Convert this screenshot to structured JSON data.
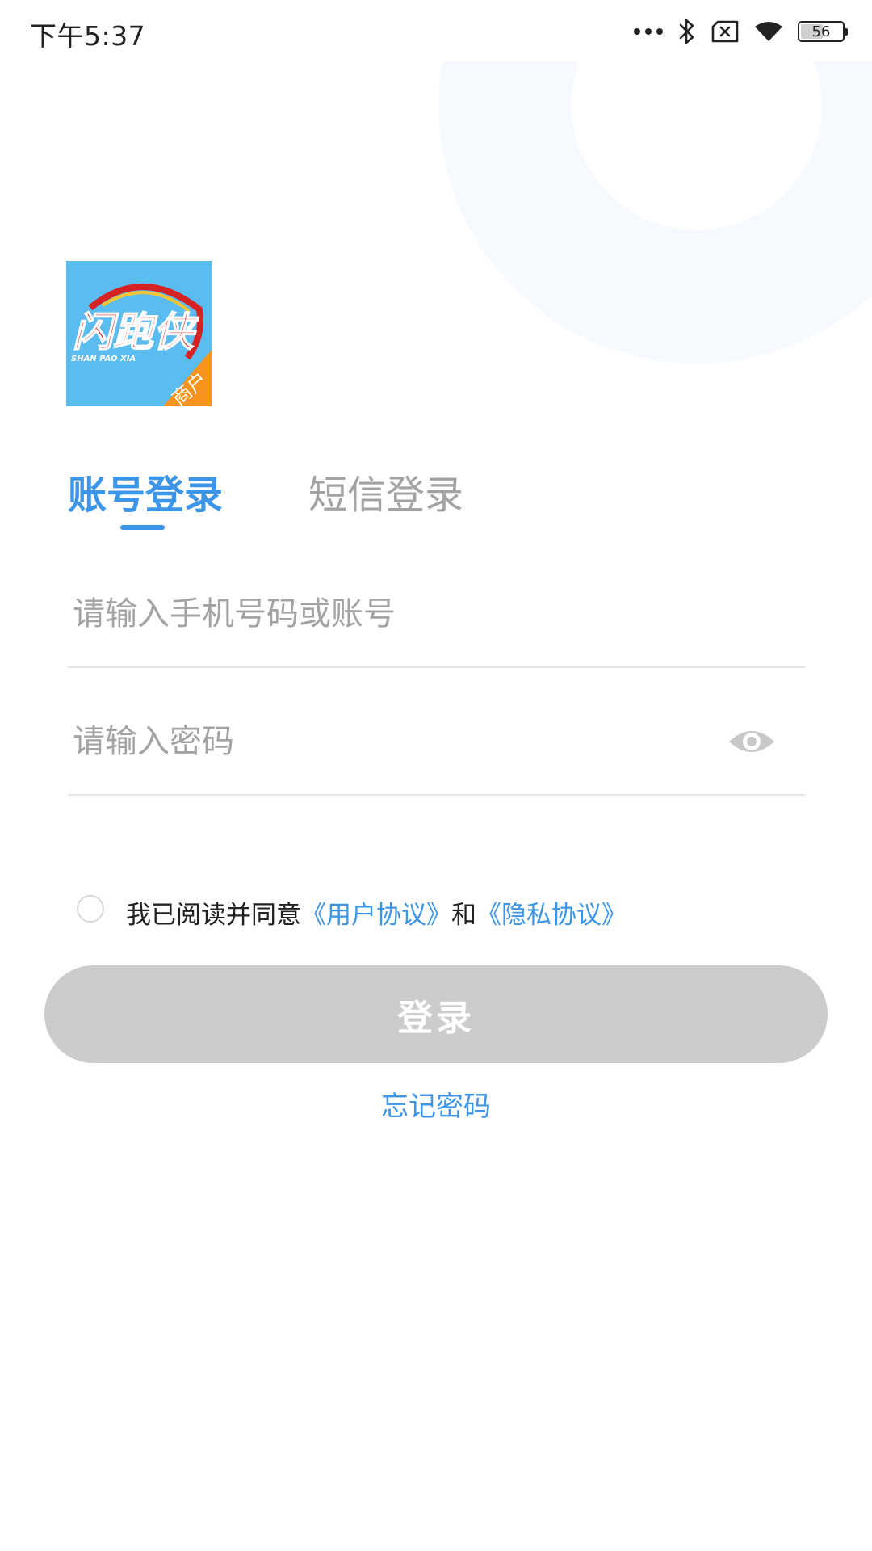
{
  "status_bar": {
    "time": "下午5:37",
    "battery_level": "56",
    "battery_fraction": 0.56
  },
  "logo": {
    "brand_text": "闪跑侠",
    "brand_pinyin": "SHAN PAO XIA",
    "badge_text": "商户",
    "colors": {
      "background": "#5bbcf0",
      "text": "#d52222",
      "badge": "#f7941d"
    }
  },
  "tabs": [
    {
      "label": "账号登录",
      "active": true
    },
    {
      "label": "短信登录",
      "active": false
    }
  ],
  "form": {
    "account_placeholder": "请输入手机号码或账号",
    "password_placeholder": "请输入密码",
    "agreement": {
      "checked": false,
      "prefix": "我已阅读并同意",
      "user_agreement": "《用户协议》",
      "conjunction": "和",
      "privacy_policy": "《隐私协议》"
    },
    "login_button": "登录",
    "forgot_password": "忘记密码"
  },
  "colors": {
    "accent": "#3d95e8",
    "disabled_button": "#cccccc",
    "placeholder": "#a3a3a3",
    "divider": "#e5e5e5"
  },
  "icons": [
    "more-dots-icon",
    "bluetooth-icon",
    "sim-off-icon",
    "wifi-icon",
    "battery-icon",
    "eye-icon"
  ]
}
